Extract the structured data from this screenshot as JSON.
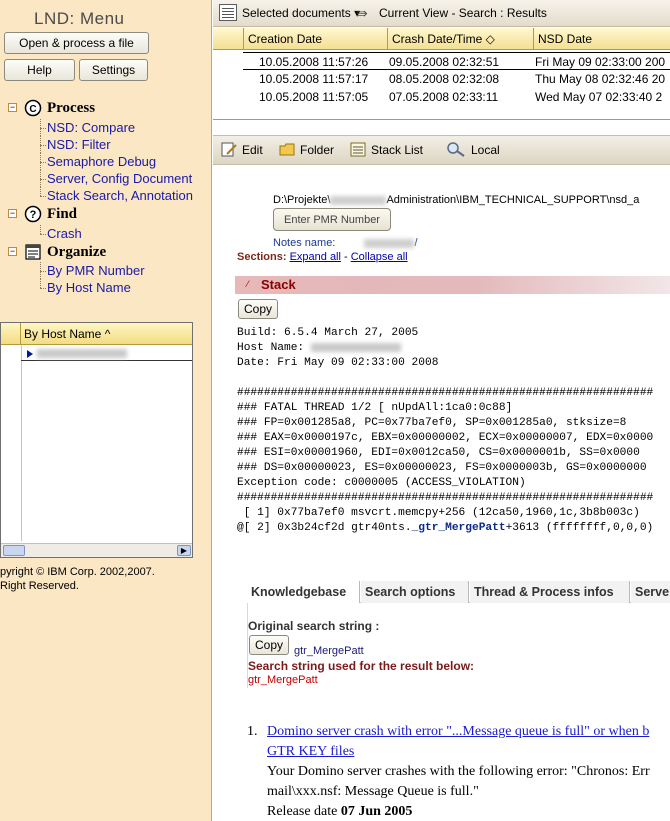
{
  "left": {
    "app_title": "LND: Menu",
    "btn_open": "Open & process a file",
    "btn_help": "Help",
    "btn_settings": "Settings",
    "groups": [
      {
        "label": "Process",
        "items": [
          "NSD: Compare",
          "NSD: Filter",
          "Semaphore Debug",
          "Server, Config Document",
          "Stack Search, Annotation"
        ]
      },
      {
        "label": "Find",
        "items": [
          "Crash"
        ]
      },
      {
        "label": "Organize",
        "items": [
          "By PMR Number",
          "By Host Name"
        ]
      }
    ],
    "mini_list_header": "By Host Name ^",
    "copyright_line1": "pyright © IBM Corp. 2002,2007.",
    "copyright_line2": "Right Reserved."
  },
  "topbar": {
    "selected_docs": "Selected documents",
    "current_view": "Current View - Search : Results"
  },
  "doc_table": {
    "headers": [
      "Creation Date",
      "Crash Date/Time ◇",
      "NSD Date"
    ],
    "rows": [
      [
        "10.05.2008 11:57:26",
        "09.05.2008 02:32:51",
        "Fri May 09 02:33:00 200"
      ],
      [
        "10.05.2008 11:57:17",
        "08.05.2008 02:32:08",
        "Thu May 08 02:32:46 20"
      ],
      [
        "10.05.2008 11:57:05",
        "07.05.2008 02:33:11",
        "Wed May 07 02:33:40 2"
      ]
    ]
  },
  "toolbar": {
    "edit": "Edit",
    "folder": "Folder",
    "stack_list": "Stack List",
    "local": "Local"
  },
  "doc": {
    "path_prefix": "D:\\Projekte\\",
    "path_suffix": "Administration\\IBM_TECHNICAL_SUPPORT\\nsd_a",
    "pmr_button": "Enter PMR Number",
    "notes_label": "Notes name:",
    "notes_suffix": "/",
    "sections_label": "Sections:",
    "expand_all": "Expand all",
    "collapse_all": "Collapse all",
    "stack_title": "Stack",
    "copy": "Copy",
    "mono_build": "Build: 6.5.4 March 27, 2005",
    "mono_host": "Host Name: ",
    "mono_date": "Date: Fri May 09 02:33:00 2008",
    "mono_hash": "##############################################################",
    "mono_fatal": "### FATAL THREAD 1/2 [ nUpdAll:1ca0:0c88]",
    "mono_fp": "### FP=0x001285a8, PC=0x77ba7ef0, SP=0x001285a0, stksize=8",
    "mono_eax": "### EAX=0x0000197c, EBX=0x00000002, ECX=0x00000007, EDX=0x0000",
    "mono_esi": "### ESI=0x00001960, EDI=0x0012ca50, CS=0x0000001b, SS=0x0000",
    "mono_ds": "### DS=0x00000023, ES=0x00000023, FS=0x0000003b, GS=0x0000000",
    "mono_exc": "Exception code: c0000005 (ACCESS_VIOLATION)",
    "mono_hash2": "##############################################################",
    "mono_f1": " [ 1] 0x77ba7ef0 msvcrt.memcpy+256 (12ca50,1960,1c,3b8b003c)",
    "mono_f2_pre": "@[ 2] 0x3b24cf2d gtr40nts.",
    "mono_f2_hl": "_gtr_MergePatt",
    "mono_f2_post": "+3613 (ffffffff,0,0,0)",
    "tabs": [
      "Knowledgebase",
      "Search options",
      "Thread & Process infos",
      "Serve"
    ],
    "orig_search_label": "Original search string :",
    "orig_search_val": "gtr_MergePatt",
    "used_search_label": "Search string used for the result below:",
    "used_search_val": "gtr_MergePatt",
    "result_num": "1.",
    "result_link1": "Domino server crash with error \"...Message queue is full\" or when b",
    "result_link2": "GTR KEY files",
    "result_desc1": "Your Domino server crashes with the following error: \"Chronos: Err",
    "result_desc2": "mail\\xxx.nsf: Message Queue is full.\"",
    "release_label": "Release date ",
    "release_val": "07 Jun 2005"
  }
}
